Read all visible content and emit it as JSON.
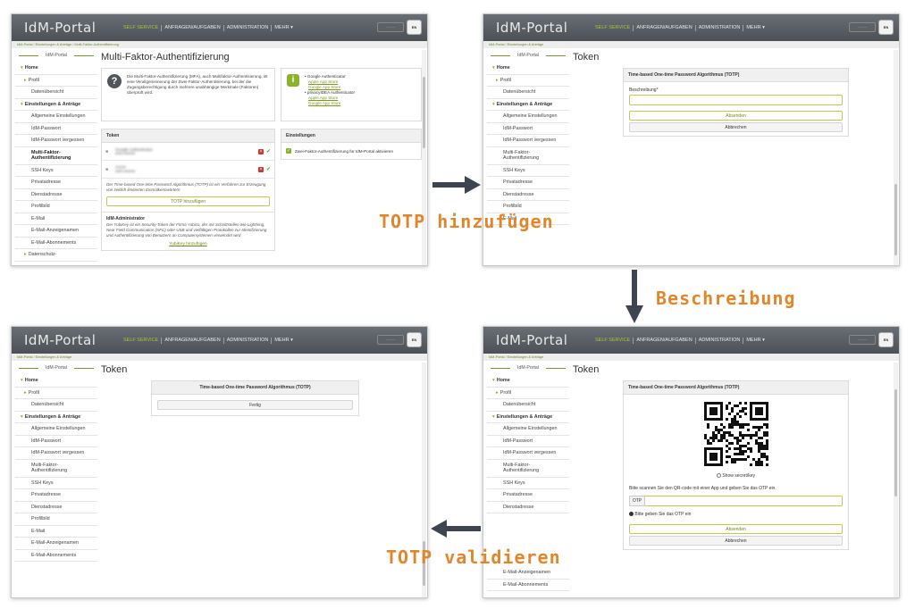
{
  "app": {
    "logo": "IdM-Portal",
    "nav": [
      "SELF SERVICE",
      "ANFRAGEN/AUFGABEN",
      "ADMINISTRATION",
      "MEHR ▾"
    ],
    "lang": "EN",
    "user_placeholder": "········"
  },
  "breadcrumbs": {
    "mfa": "IdM-Portal / Einstellungen & Anträge / Multi-Faktor-Authentifizierung",
    "token": "IdM-Portal / Einstellungen & Anträge"
  },
  "sidebar": {
    "title": "IdM-Portal",
    "home": "Home",
    "profil": "Profil",
    "datenuebersicht": "Datenübersicht",
    "einstellungen": "Einstellungen & Anträge",
    "allgemeine": "Allgemeine Einstellungen",
    "passwort": "IdM-Passwort",
    "passwort_vergessen": "IdM-Passwort vergessen",
    "mfa": "Multi-Faktor-Authentifizierung",
    "ssh": "SSH Keys",
    "privatadresse": "Privatadresse",
    "dienstadresse": "Dienstadresse",
    "profilbild": "Profilbild",
    "email": "E-Mail",
    "email_anzeigenamen": "E-Mail-Anzeigenamen",
    "email_abonnements": "E-Mail-Abonnements",
    "datenschutz": "Datenschutz-"
  },
  "mfa_page": {
    "title": "Multi-Faktor-Authentifizierung",
    "description": "Die Multi-Faktor-Authentifizierung (MFA), auch Multifaktor-Authentisierung, ist eine Verallgemeinerung der Zwei-Faktor-Authentisierung, bei der die Zugangsberechtigung durch mehrere unabhängige Merkmale (Faktoren) überprüft wird.",
    "apps": {
      "google": "Google Authenticator",
      "apple1": "Apple App Store",
      "gplay1": "Google App Store",
      "privacyidea": "privacyIDEA Authenticator",
      "apple2": "Apple App Store",
      "gplay2": "Google App Store"
    },
    "token_header": "Token",
    "token1_name": "Google Authenticator",
    "token1_sub": "#### ######",
    "token2_name": "TOTP",
    "token2_sub": "#### ######",
    "totp_note": "Der Time-based One-time Password Algorithmus (TOTP) ist ein Verfahren zur Erzeugung von zeitlich limitierten Einmalkennwörtern",
    "totp_button": "TOTP hinzufügen",
    "admin_title": "IdM-Administrator",
    "yubikey_note": "Der YubiKey ist ein Security-Token der Firma Yubico, der mit Schnittstellen wie Lightning, Near Field Communication (NFC) oder USB und vielfältigen Protokollen zur Identifizierung und Authentifizierung von Benutzern an Computersystemen verwendet wird",
    "yubikey_button": "YubiKey hinzufügen",
    "settings_header": "Einstellungen",
    "settings_option": "Zwei-Faktor-Authentifizierung für IdM-Portal aktivieren"
  },
  "token_page": {
    "title": "Token",
    "card_header": "Time-based One-time Password Algorithmus (TOTP)",
    "beschreibung_label": "Beschreibung*",
    "absenden": "Absenden",
    "abbrechen": "Abbrechen",
    "show_secret": "Show secret/key",
    "scan_instruction": "Bitte scannen Sie den QR-code mit einer App und geben Sie das OTP ein.",
    "otp_label": "OTP",
    "otp_hint": "Bitte geben Sie das OTP ein",
    "fertig": "Fertig"
  },
  "steps": {
    "step1": "TOTP hinzufügen",
    "step2": "Beschreibung",
    "step3": "TOTP validieren"
  },
  "colors": {
    "accent_green": "#8ab32a",
    "arrow": "#3d4650",
    "step_label": "#e2862a"
  }
}
